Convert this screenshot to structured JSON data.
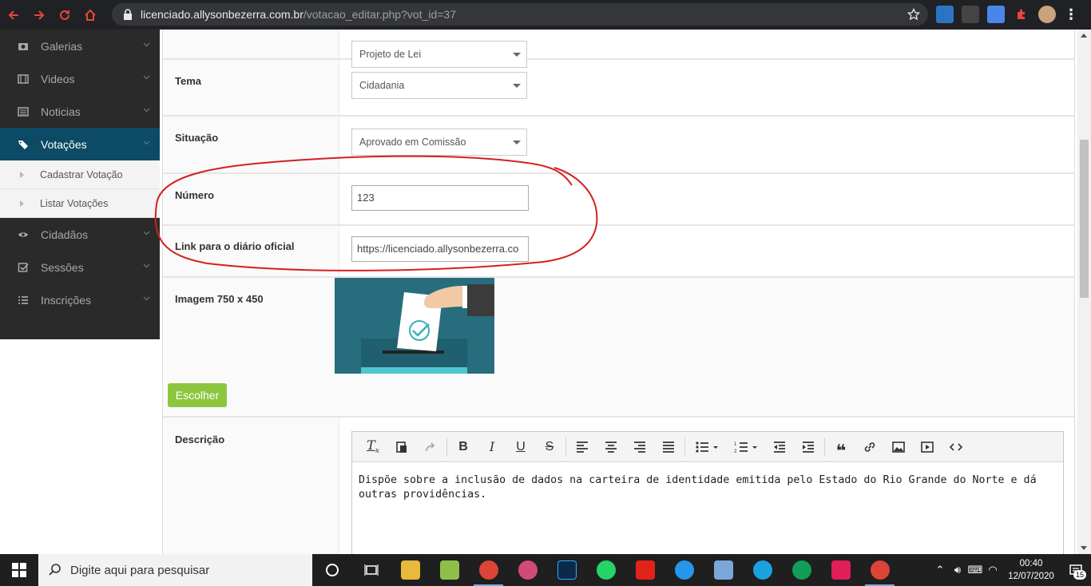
{
  "browser": {
    "url_host": "licenciado.allysonbezerra.com.br",
    "url_path": "/votacao_editar.php?vot_id=37"
  },
  "sidebar": {
    "items": [
      {
        "label": "Galerias",
        "icon": "camera-icon"
      },
      {
        "label": "Videos",
        "icon": "film-icon"
      },
      {
        "label": "Noticias",
        "icon": "newspaper-icon"
      },
      {
        "label": "Votações",
        "icon": "tags-icon",
        "active": true
      },
      {
        "label": "Cidadãos",
        "icon": "eye-icon"
      },
      {
        "label": "Sessões",
        "icon": "check-square-icon"
      },
      {
        "label": "Inscrições",
        "icon": "list-icon"
      }
    ],
    "subitems": [
      {
        "label": "Cadastrar Votação"
      },
      {
        "label": "Listar Votações"
      }
    ]
  },
  "form": {
    "top_select_value": "Projeto de Lei",
    "tema": {
      "label": "Tema",
      "value": "Cidadania"
    },
    "situacao": {
      "label": "Situação",
      "value": "Aprovado em Comissão"
    },
    "numero": {
      "label": "Número",
      "value": "123"
    },
    "link": {
      "label": "Link para o diário oficial",
      "value": "https://licenciado.allysonbezerra.co"
    },
    "imagem": {
      "label": "Imagem 750 x 450"
    },
    "choose_button": "Escolher",
    "descricao": {
      "label": "Descrição",
      "text": "Dispõe sobre a inclusão de dados na carteira de identidade emitida pelo Estado do Rio Grande do Norte e dá outras providências."
    }
  },
  "taskbar": {
    "search_placeholder": "Digite aqui para pesquisar",
    "time": "00:40",
    "date": "12/07/2020",
    "notification_count": "15"
  },
  "colors": {
    "sidebar_bg": "#2a2a2a",
    "sidebar_active": "#0d4a66",
    "choose_button": "#8cc63f",
    "annotation_red": "#d42020"
  }
}
